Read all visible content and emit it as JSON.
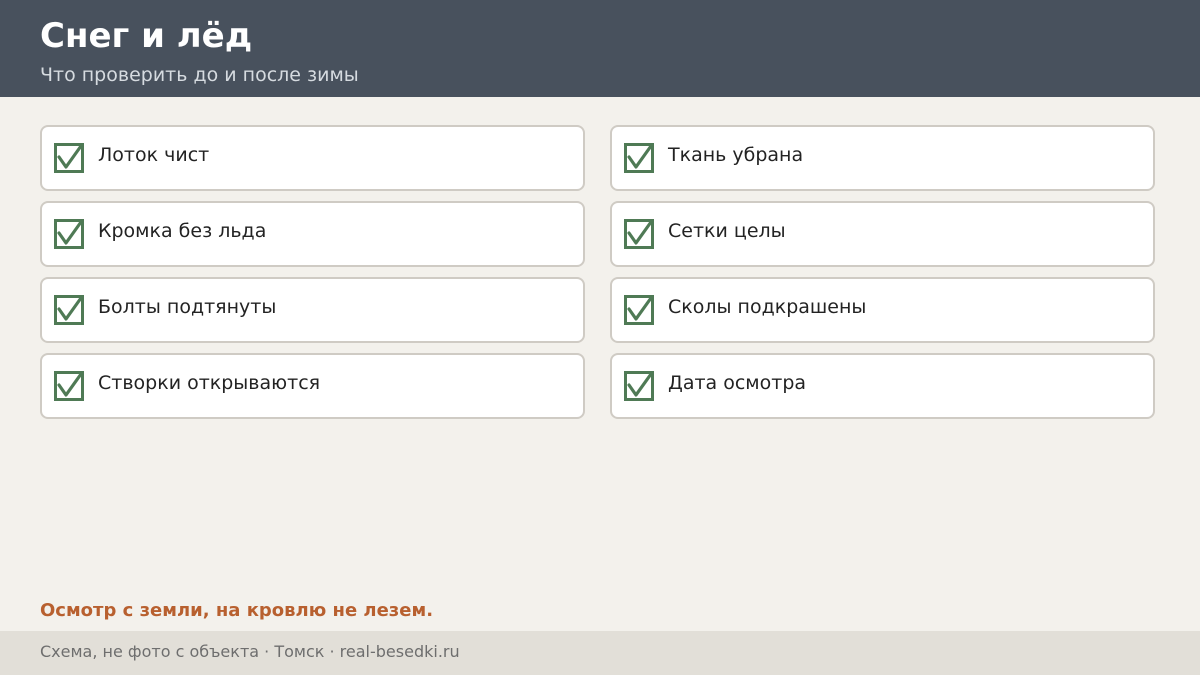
{
  "header": {
    "title": "Снег и лёд",
    "subtitle": "Что проверить до и после зимы"
  },
  "checklist": [
    {
      "label": "Лоток чист",
      "checked": true
    },
    {
      "label": "Ткань убрана",
      "checked": true
    },
    {
      "label": "Кромка без льда",
      "checked": true
    },
    {
      "label": "Сетки целы",
      "checked": true
    },
    {
      "label": "Болты подтянуты",
      "checked": true
    },
    {
      "label": "Сколы подкрашены",
      "checked": true
    },
    {
      "label": "Створки открываются",
      "checked": true
    },
    {
      "label": "Дата осмотра",
      "checked": true
    }
  ],
  "note": "Осмотр с земли, на кровлю не лезем.",
  "footer": {
    "text": "Схема, не фото с объекта  ·  Томск  ·  real-besedki.ru"
  },
  "colors": {
    "header_bg": "#48515d",
    "check_green": "#4f7a55",
    "note_accent": "#b8602f"
  }
}
